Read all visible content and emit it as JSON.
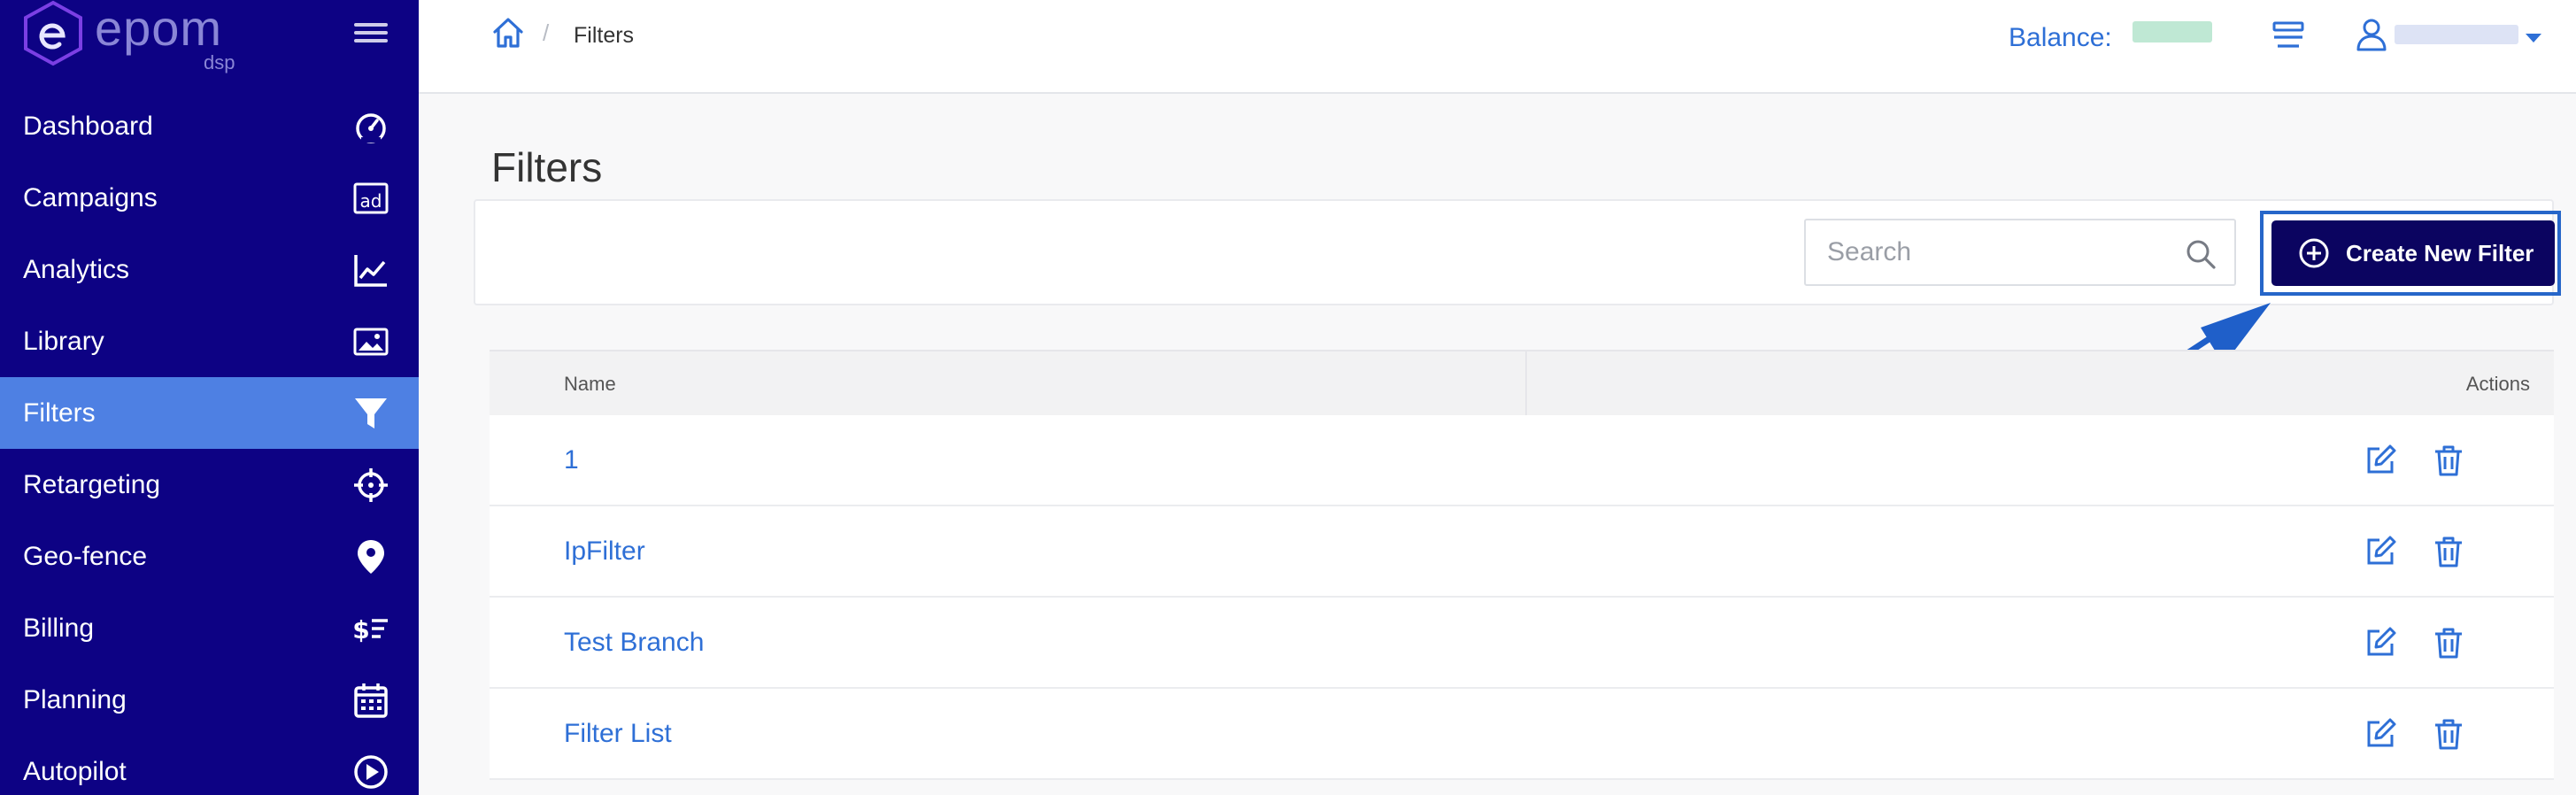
{
  "brand": {
    "name": "epom",
    "sub": "dsp",
    "logo_letter": "e"
  },
  "sidebar": {
    "items": [
      {
        "label": "Dashboard",
        "icon": "dashboard-gauge-icon",
        "active": false
      },
      {
        "label": "Campaigns",
        "icon": "ad-icon",
        "active": false
      },
      {
        "label": "Analytics",
        "icon": "analytics-chart-icon",
        "active": false
      },
      {
        "label": "Library",
        "icon": "image-icon",
        "active": false
      },
      {
        "label": "Filters",
        "icon": "filter-icon",
        "active": true
      },
      {
        "label": "Retargeting",
        "icon": "crosshair-icon",
        "active": false
      },
      {
        "label": "Geo-fence",
        "icon": "map-pin-icon",
        "active": false
      },
      {
        "label": "Billing",
        "icon": "billing-icon",
        "active": false
      },
      {
        "label": "Planning",
        "icon": "calendar-icon",
        "active": false
      },
      {
        "label": "Autopilot",
        "icon": "play-circle-icon",
        "active": false
      }
    ]
  },
  "header": {
    "breadcrumb_separator": "/",
    "breadcrumb_current": "Filters",
    "balance_label": "Balance:"
  },
  "main": {
    "title": "Filters",
    "search_placeholder": "Search",
    "create_button_label": "Create New Filter"
  },
  "table": {
    "columns": {
      "name": "Name",
      "actions": "Actions"
    },
    "rows": [
      {
        "name": "1"
      },
      {
        "name": "IpFilter"
      },
      {
        "name": "Test Branch"
      },
      {
        "name": "Filter List"
      }
    ]
  },
  "colors": {
    "sidebar_bg": "#0d0284",
    "sidebar_active": "#4e80e3",
    "link": "#2e6fd6",
    "button_bg": "#0b0460",
    "annotation_arrow": "#1f5fc9"
  }
}
